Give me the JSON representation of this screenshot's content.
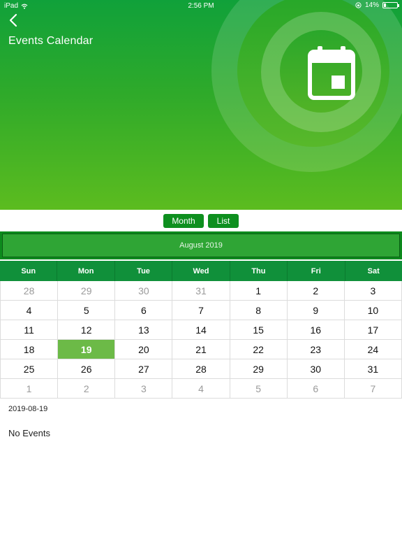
{
  "status_bar": {
    "device": "iPad",
    "time": "2:56 PM",
    "battery_percent": "14%",
    "battery_level": 0.14
  },
  "header": {
    "title": "Events Calendar",
    "colors": {
      "gradient_top": "#10a13a",
      "gradient_bottom": "#5cbc1f"
    }
  },
  "view_toggle": {
    "month_label": "Month",
    "list_label": "List",
    "accent": "#0e8f1f"
  },
  "month_bar": {
    "label": "August 2019"
  },
  "calendar": {
    "weekdays": [
      "Sun",
      "Mon",
      "Tue",
      "Wed",
      "Thu",
      "Fri",
      "Sat"
    ],
    "weeks": [
      [
        {
          "d": "28",
          "m": true
        },
        {
          "d": "29",
          "m": true
        },
        {
          "d": "30",
          "m": true
        },
        {
          "d": "31",
          "m": true
        },
        {
          "d": "1"
        },
        {
          "d": "2"
        },
        {
          "d": "3"
        }
      ],
      [
        {
          "d": "4"
        },
        {
          "d": "5"
        },
        {
          "d": "6"
        },
        {
          "d": "7"
        },
        {
          "d": "8"
        },
        {
          "d": "9"
        },
        {
          "d": "10"
        }
      ],
      [
        {
          "d": "11"
        },
        {
          "d": "12"
        },
        {
          "d": "13"
        },
        {
          "d": "14"
        },
        {
          "d": "15"
        },
        {
          "d": "16"
        },
        {
          "d": "17"
        }
      ],
      [
        {
          "d": "18"
        },
        {
          "d": "19",
          "s": true
        },
        {
          "d": "20"
        },
        {
          "d": "21"
        },
        {
          "d": "22"
        },
        {
          "d": "23"
        },
        {
          "d": "24"
        }
      ],
      [
        {
          "d": "25"
        },
        {
          "d": "26"
        },
        {
          "d": "27"
        },
        {
          "d": "28"
        },
        {
          "d": "29"
        },
        {
          "d": "30"
        },
        {
          "d": "31"
        }
      ],
      [
        {
          "d": "1",
          "m": true
        },
        {
          "d": "2",
          "m": true
        },
        {
          "d": "3",
          "m": true
        },
        {
          "d": "4",
          "m": true
        },
        {
          "d": "5",
          "m": true
        },
        {
          "d": "6",
          "m": true
        },
        {
          "d": "7",
          "m": true
        }
      ]
    ],
    "selected_color": "#6cba47"
  },
  "events": {
    "selected_date": "2019-08-19",
    "empty_message": "No Events"
  },
  "icons": [
    "back-chevron-icon",
    "calendar-icon",
    "wifi-icon",
    "orientation-lock-icon",
    "battery-icon"
  ]
}
